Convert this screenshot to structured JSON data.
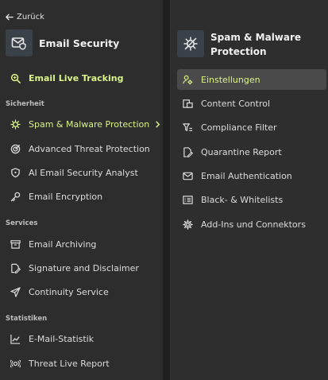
{
  "nav": {
    "back_label": "Zurück"
  },
  "left": {
    "title": "Email Security",
    "live_tracking": "Email Live Tracking",
    "sections": [
      {
        "title": "Sicherheit",
        "items": [
          {
            "label": "Spam & Malware Protection",
            "icon": "virus-icon",
            "active": true
          },
          {
            "label": "Advanced Threat Protection",
            "icon": "target-icon"
          },
          {
            "label": "AI Email Security Analyst",
            "icon": "shield-icon"
          },
          {
            "label": "Email Encryption",
            "icon": "key-icon"
          }
        ]
      },
      {
        "title": "Services",
        "items": [
          {
            "label": "Email Archiving",
            "icon": "archive-icon"
          },
          {
            "label": "Signature and Disclaimer",
            "icon": "signature-icon"
          },
          {
            "label": "Continuity Service",
            "icon": "send-icon"
          }
        ]
      },
      {
        "title": "Statistiken",
        "items": [
          {
            "label": "E-Mail-Statistik",
            "icon": "chart-icon"
          },
          {
            "label": "Threat Live Report",
            "icon": "live-icon"
          }
        ]
      }
    ]
  },
  "right": {
    "title": "Spam & Malware Protection",
    "items": [
      {
        "label": "Einstellungen",
        "icon": "user-settings-icon",
        "selected": true
      },
      {
        "label": "Content Control",
        "icon": "content-icon"
      },
      {
        "label": "Compliance Filter",
        "icon": "filter-icon"
      },
      {
        "label": "Quarantine Report",
        "icon": "report-icon"
      },
      {
        "label": "Email Authentication",
        "icon": "mail-check-icon"
      },
      {
        "label": "Black- & Whitelists",
        "icon": "list-icon"
      },
      {
        "label": "Add-Ins und Connektors",
        "icon": "gear-icon"
      }
    ]
  },
  "colors": {
    "accent": "#d9f28a",
    "bg": "#2d2d2d",
    "selected_bg": "#4a4a4a",
    "divider": "#1f1f1f"
  }
}
